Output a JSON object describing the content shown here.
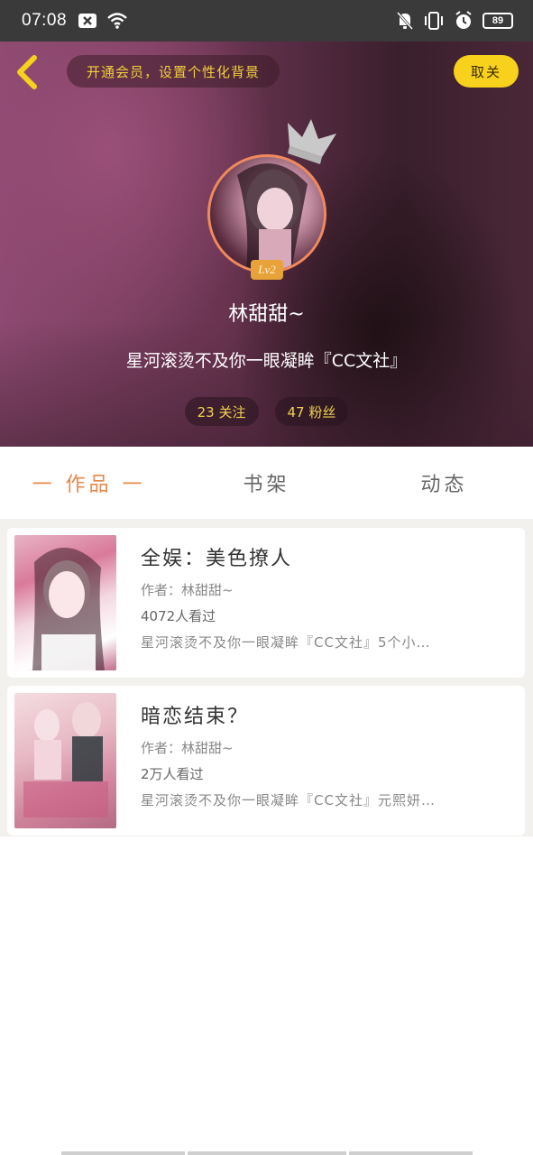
{
  "status_bar": {
    "time": "07:08",
    "battery": "89"
  },
  "header": {
    "vip_banner": "开通会员，设置个性化背景",
    "close_label": "取关",
    "level_badge": "Lv2",
    "username": "林甜甜~",
    "signature": "星河滚烫不及你一眼凝眸『CC文社』",
    "following": "23 关注",
    "followers": "47 粉丝"
  },
  "tabs": [
    {
      "label": "一 作品 一",
      "active": true
    },
    {
      "label": "书架",
      "active": false
    },
    {
      "label": "动态",
      "active": false
    }
  ],
  "books": [
    {
      "title": "全娱：美色撩人",
      "author": "作者：林甜甜~",
      "views": "4072人看过",
      "desc": "星河滚烫不及你一眼凝眸『CC文社』5个小…"
    },
    {
      "title": "暗恋结束？",
      "author": "作者：林甜甜~",
      "views": "2万人看过",
      "desc": "星河滚烫不及你一眼凝眸『CC文社』元熙妍…"
    }
  ],
  "colors": {
    "accent": "#e8884a",
    "vip_yellow": "#f7d11c",
    "stat_text": "#f3d34c"
  }
}
